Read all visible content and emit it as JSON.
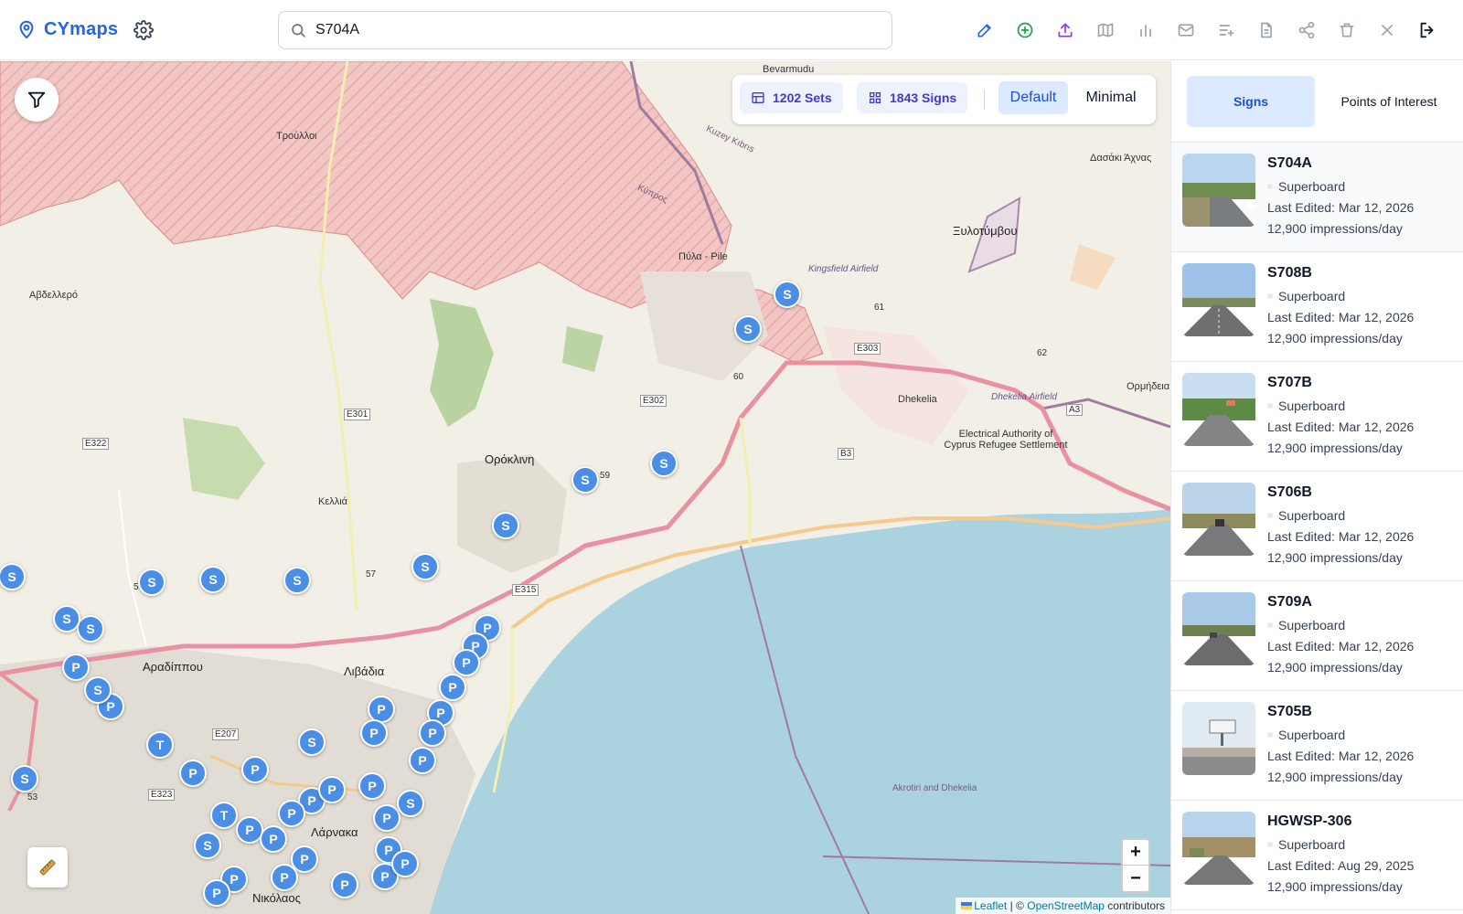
{
  "app": {
    "name": "CYmaps",
    "icon": "map-pin-icon"
  },
  "search": {
    "value": "S704A",
    "icon": "search-icon"
  },
  "toolbar": {
    "items": [
      {
        "name": "edit",
        "icon": "pencil-icon",
        "color": "#2563eb"
      },
      {
        "name": "add",
        "icon": "plus-circle-icon",
        "color": "#16a34a"
      },
      {
        "name": "upload",
        "icon": "upload-icon",
        "color": "#9333ea"
      },
      {
        "name": "map",
        "icon": "map-icon",
        "color": "#9ca3af"
      },
      {
        "name": "stats",
        "icon": "bar-chart-icon",
        "color": "#9ca3af"
      },
      {
        "name": "mail",
        "icon": "mail-icon",
        "color": "#9ca3af"
      },
      {
        "name": "list-add",
        "icon": "list-plus-icon",
        "color": "#9ca3af"
      },
      {
        "name": "document",
        "icon": "file-icon",
        "color": "#9ca3af"
      },
      {
        "name": "share",
        "icon": "share-icon",
        "color": "#9ca3af"
      },
      {
        "name": "delete",
        "icon": "trash-icon",
        "color": "#9ca3af"
      },
      {
        "name": "close",
        "icon": "close-icon",
        "color": "#9ca3af"
      },
      {
        "name": "logout",
        "icon": "logout-icon",
        "color": "#111827"
      }
    ]
  },
  "map_controls": {
    "sets_label": "1202 Sets",
    "signs_label": "1843 Signs",
    "modes": [
      "Default",
      "Minimal"
    ],
    "active_mode": "Default"
  },
  "map": {
    "places": [
      {
        "label": "Bevarmudu",
        "big": false
      },
      {
        "label": "Τρούλλοι",
        "big": false
      },
      {
        "label": "Αβδελλερό",
        "big": false
      },
      {
        "label": "Πύλα - Pile",
        "big": false
      },
      {
        "label": "Ξυλοτύμβου",
        "big": true
      },
      {
        "label": "Δασάκι Άχνας",
        "big": false
      },
      {
        "label": "Dhekelia",
        "big": false
      },
      {
        "label": "Ορμήδεια",
        "big": false
      },
      {
        "label": "Ορόκλινη",
        "big": true
      },
      {
        "label": "Κελλιά",
        "big": false
      },
      {
        "label": "Αραδίππου",
        "big": true
      },
      {
        "label": "Λιβάδια",
        "big": true
      },
      {
        "label": "Λάρνακα",
        "big": true
      },
      {
        "label": "Electrical Authority of Cyprus Refugee Settlement",
        "big": false
      },
      {
        "label": "Kingsfield Airfield",
        "big": false
      },
      {
        "label": "Dhekelia Airfield",
        "big": false
      },
      {
        "label": "Akrotiri and Dhekelia",
        "big": false
      },
      {
        "label": "Κύπρος",
        "big": false
      },
      {
        "label": "Kuzey Kıbrıs",
        "big": false
      },
      {
        "label": "E303",
        "big": false
      },
      {
        "label": "E302",
        "big": false
      },
      {
        "label": "E301",
        "big": false
      },
      {
        "label": "E322",
        "big": false
      },
      {
        "label": "E315",
        "big": false
      },
      {
        "label": "E207",
        "big": false
      },
      {
        "label": "E323",
        "big": false
      },
      {
        "label": "B3",
        "big": false
      },
      {
        "label": "A3",
        "big": false
      },
      {
        "label": "61",
        "big": false
      },
      {
        "label": "62",
        "big": false
      },
      {
        "label": "60",
        "big": false
      },
      {
        "label": "59",
        "big": false
      },
      {
        "label": "57",
        "big": false
      },
      {
        "label": "56",
        "big": false
      },
      {
        "label": "53",
        "big": false
      },
      {
        "label": "Νικόλαος",
        "big": false
      }
    ],
    "marker_labels": [
      "S",
      "S",
      "S",
      "S",
      "S",
      "S",
      "S",
      "S",
      "S",
      "S",
      "S",
      "S",
      "P",
      "P",
      "P",
      "P",
      "P",
      "P",
      "P",
      "P",
      "P",
      "P",
      "P",
      "P",
      "P",
      "P",
      "T",
      "T",
      "S",
      "S",
      "S",
      "P",
      "P",
      "P",
      "P",
      "P",
      "P",
      "P",
      "S",
      "P",
      "P",
      "P",
      "S",
      "P",
      "P",
      "P",
      "P"
    ],
    "zoom_in": "+",
    "zoom_out": "−",
    "attribution": {
      "lib": "Leaflet",
      "sep": "| ©",
      "osm": "OpenStreetMap",
      "suffix": "contributors"
    }
  },
  "panel": {
    "tabs": [
      "Signs",
      "Points of Interest"
    ],
    "active_tab": "Signs",
    "signs": [
      {
        "code": "S704A",
        "type": "Superboard",
        "edited": "Last Edited: Mar 12, 2026",
        "impressions": "12,900 impressions/day"
      },
      {
        "code": "S708B",
        "type": "Superboard",
        "edited": "Last Edited: Mar 12, 2026",
        "impressions": "12,900 impressions/day"
      },
      {
        "code": "S707B",
        "type": "Superboard",
        "edited": "Last Edited: Mar 12, 2026",
        "impressions": "12,900 impressions/day"
      },
      {
        "code": "S706B",
        "type": "Superboard",
        "edited": "Last Edited: Mar 12, 2026",
        "impressions": "12,900 impressions/day"
      },
      {
        "code": "S709A",
        "type": "Superboard",
        "edited": "Last Edited: Mar 12, 2026",
        "impressions": "12,900 impressions/day"
      },
      {
        "code": "S705B",
        "type": "Superboard",
        "edited": "Last Edited: Mar 12, 2026",
        "impressions": "12,900 impressions/day"
      },
      {
        "code": "HGWSP-306",
        "type": "Superboard",
        "edited": "Last Edited: Aug 29, 2025",
        "impressions": "12,900 impressions/day"
      }
    ]
  }
}
